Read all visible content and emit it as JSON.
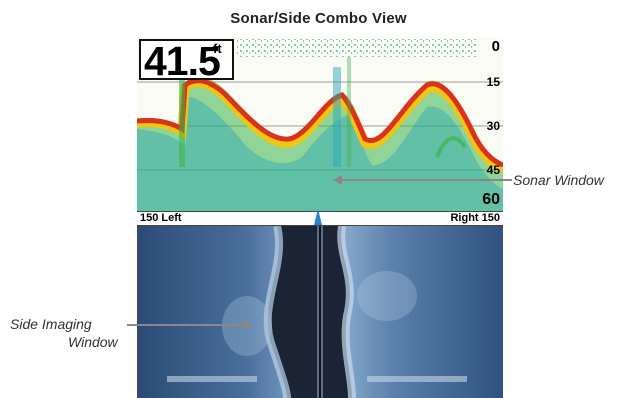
{
  "title": "Sonar/Side Combo View",
  "sonar": {
    "depth_value": "41.5",
    "depth_unit": "ft",
    "scale": [
      "0",
      "15",
      "30",
      "45",
      "60"
    ]
  },
  "side_bar": {
    "left_label": "150 Left",
    "right_label": "Right 150"
  },
  "callouts": {
    "sonar_window": "Sonar Window",
    "side_imaging_window_line1": "Side Imaging",
    "side_imaging_window_line2": "Window"
  },
  "colors": {
    "sonar_background": "#fbfbf6",
    "sonar_return_strong": "#d9331c",
    "sonar_return_medium": "#f2c511",
    "sonar_return_weak": "#3ab54a",
    "sonar_return_faint": "#2aa8b8",
    "side_imaging_background": "#2d4f7a",
    "boat_marker": "#2b7fd0"
  },
  "icons": {
    "boat_marker": "boat-position-marker-icon"
  }
}
